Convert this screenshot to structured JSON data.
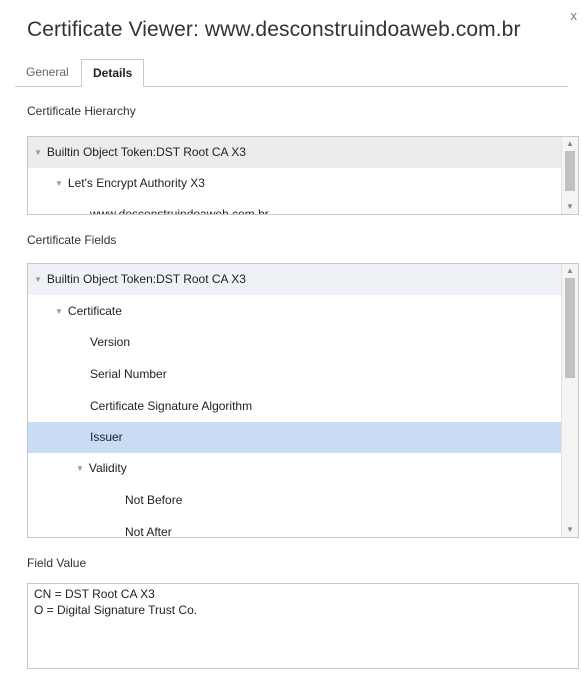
{
  "window": {
    "title": "Certificate Viewer: www.desconstruindoaweb.com.br",
    "close": "x"
  },
  "tabs": [
    {
      "label": "General",
      "active": false
    },
    {
      "label": "Details",
      "active": true
    }
  ],
  "hierarchy": {
    "label": "Certificate Hierarchy",
    "items": [
      "Builtin Object Token:DST Root CA X3",
      "Let's Encrypt Authority X3",
      "www.desconstruindoaweb.com.br"
    ]
  },
  "fields": {
    "label": "Certificate Fields",
    "items": [
      "Builtin Object Token:DST Root CA X3",
      "Certificate",
      "Version",
      "Serial Number",
      "Certificate Signature Algorithm",
      "Issuer",
      "Validity",
      "Not Before",
      "Not After"
    ],
    "selected": "Issuer"
  },
  "field_value": {
    "label": "Field Value",
    "lines": [
      "CN = DST Root CA X3",
      "O = Digital Signature Trust Co."
    ]
  },
  "icons": {
    "expand": "triangle-down-icon",
    "scroll_up": "scroll-up-arrow-icon",
    "scroll_down": "scroll-down-arrow-icon"
  },
  "colors": {
    "selected_row": "#c9dcf6",
    "border": "#c8c8c8"
  }
}
